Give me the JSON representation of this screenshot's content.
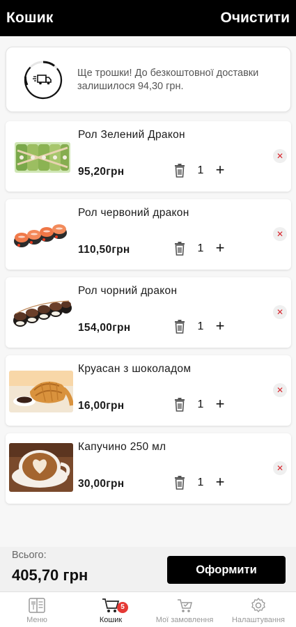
{
  "header": {
    "title": "Кошик",
    "clear_label": "Очистити"
  },
  "delivery": {
    "icon": "delivery-truck-icon",
    "message": "Ще трошки! До безкоштовної доставки залишилося 94,30 грн.",
    "progress": 0.1
  },
  "cart": {
    "items": [
      {
        "name": "Рол Зелений Дракон",
        "price": "95,20грн",
        "qty": "1",
        "image": "green-dragon-roll"
      },
      {
        "name": "Рол червоний дракон",
        "price": "110,50грн",
        "qty": "1",
        "image": "red-dragon-roll"
      },
      {
        "name": "Рол чорний дракон",
        "price": "154,00грн",
        "qty": "1",
        "image": "black-dragon-roll"
      },
      {
        "name": "Круасан з шоколадом",
        "price": "16,00грн",
        "qty": "1",
        "image": "chocolate-croissant"
      },
      {
        "name": "Капучино 250 мл",
        "price": "30,00грн",
        "qty": "1",
        "image": "cappuccino"
      }
    ],
    "remove_symbol": "✕",
    "plus_symbol": "+"
  },
  "total": {
    "label": "Всього:",
    "value": "405,70 грн",
    "checkout_label": "Оформити"
  },
  "nav": {
    "items": [
      {
        "label": "Меню",
        "icon": "menu-icon"
      },
      {
        "label": "Кошик",
        "icon": "cart-icon",
        "badge": "5"
      },
      {
        "label": "Мої замовлення",
        "icon": "orders-icon"
      },
      {
        "label": "Налаштування",
        "icon": "settings-icon"
      }
    ]
  },
  "colors": {
    "header_bg": "#000000",
    "remove_x": "#d8262e",
    "badge": "#e53935"
  }
}
